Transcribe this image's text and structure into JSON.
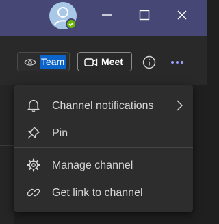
{
  "titlebar": {
    "avatar_icon": "user-avatar-icon",
    "presence_status": "available",
    "presence_color": "#6bb700",
    "controls": [
      "minimize-icon",
      "maximize-icon",
      "close-icon"
    ]
  },
  "toolbar": {
    "team_button_label": "Team",
    "meet_button_label": "Meet",
    "team_icon": "eye-icon",
    "meet_icon": "video-camera-icon",
    "info_icon": "info-icon",
    "more_icon": "more-options-icon"
  },
  "menu": {
    "items": [
      {
        "label": "Channel notifications",
        "icon": "bell-icon",
        "has_submenu": true
      },
      {
        "label": "Pin",
        "icon": "pin-icon",
        "has_submenu": false
      },
      {
        "label": "Manage channel",
        "icon": "gear-icon",
        "has_submenu": false
      },
      {
        "label": "Get link to channel",
        "icon": "link-icon",
        "has_submenu": false
      }
    ]
  },
  "colors": {
    "titlebar_bg": "#464775",
    "menu_bg": "#2d2d2d",
    "selection": "#0a64c9",
    "text": "#d6d6d6"
  }
}
